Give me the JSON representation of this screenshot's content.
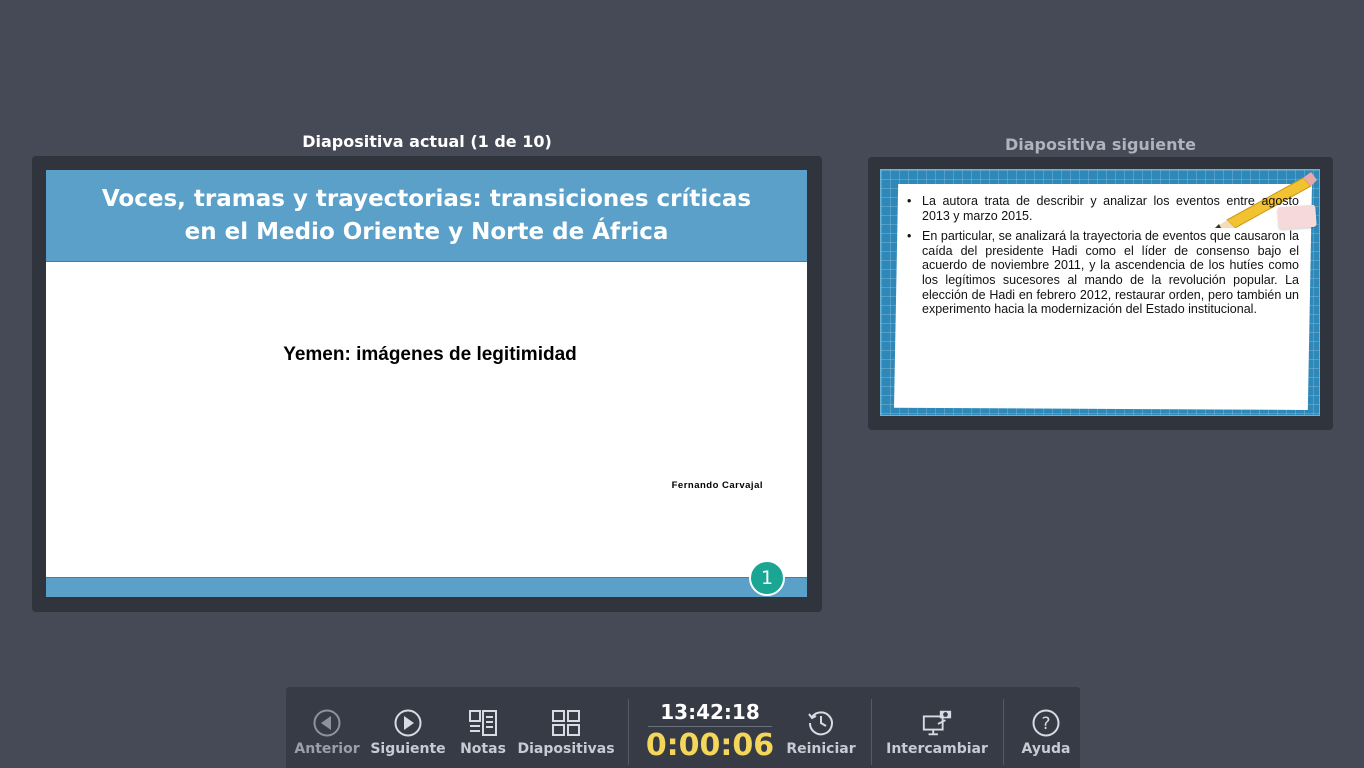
{
  "current": {
    "caption": "Diapositiva actual (1 de 10)",
    "slide": {
      "title": "Voces, tramas y trayectorias: transiciones críticas en el Medio Oriente y Norte de África",
      "subtitle": "Yemen: imágenes de legitimidad",
      "author": "Fernando Carvajal",
      "number": "1"
    }
  },
  "next": {
    "caption": "Diapositiva siguiente",
    "bullets": [
      "La autora trata de describir y analizar los eventos entre agosto 2013 y marzo 2015.",
      "En particular, se analizará la trayectoria de eventos que causaron la caída del presidente Hadi como el líder de consenso bajo el acuerdo de noviembre 2011, y la ascendencia de los hutíes como los legítimos sucesores al mando de la revolución popular. La elección de Hadi en febrero 2012, restaurar orden, pero también un experimento hacia la modernización del Estado institucional."
    ]
  },
  "toolbar": {
    "previous_label": "Anterior",
    "next_label": "Siguiente",
    "notes_label": "Notas",
    "slides_label": "Diapositivas",
    "clock": "13:42:18",
    "timer": "0:00:06",
    "restart_label": "Reiniciar",
    "swap_label": "Intercambiar",
    "help_label": "Ayuda"
  },
  "colors": {
    "background": "#454a56",
    "slide_accent": "#5aa0c8",
    "timer": "#f3d65a",
    "slide_number": "#1aa693"
  }
}
